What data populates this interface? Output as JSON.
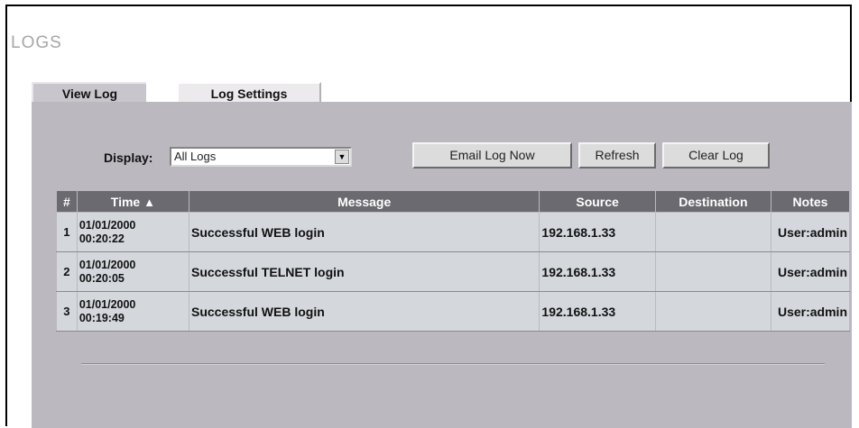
{
  "page": {
    "title": "LOGS"
  },
  "tabs": [
    {
      "label": "View Log",
      "active": true
    },
    {
      "label": "Log Settings",
      "active": false
    }
  ],
  "controls": {
    "display_label": "Display:",
    "display_value": "All Logs",
    "email_button": "Email Log Now",
    "refresh_button": "Refresh",
    "clear_button": "Clear Log"
  },
  "table": {
    "headers": {
      "num": "#",
      "time": "Time",
      "message": "Message",
      "source": "Source",
      "destination": "Destination",
      "notes": "Notes"
    },
    "rows": [
      {
        "num": "1",
        "date": "01/01/2000",
        "time": "00:20:22",
        "message": "Successful WEB login",
        "source": "192.168.1.33",
        "destination": "",
        "notes": "User:admin"
      },
      {
        "num": "2",
        "date": "01/01/2000",
        "time": "00:20:05",
        "message": "Successful TELNET login",
        "source": "192.168.1.33",
        "destination": "",
        "notes": "User:admin"
      },
      {
        "num": "3",
        "date": "01/01/2000",
        "time": "00:19:49",
        "message": "Successful WEB login",
        "source": "192.168.1.33",
        "destination": "",
        "notes": "User:admin"
      }
    ]
  },
  "colors": {
    "panel": "#bcb8bf",
    "header": "#6b6a70",
    "row": "#d4d7dc"
  }
}
